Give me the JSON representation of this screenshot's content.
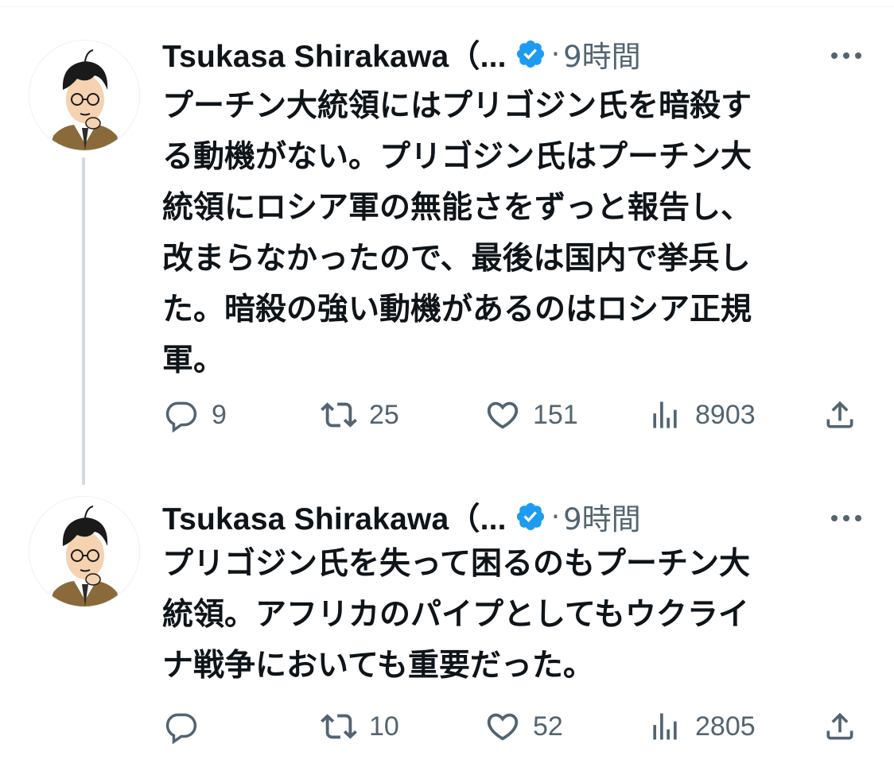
{
  "tweets": [
    {
      "display_name": "Tsukasa Shirakawa（...",
      "separator": "·",
      "time": "9時間",
      "text_lines": [
        "プーチン大統領にはプリゴジン氏を暗殺す",
        "る動機がない。プリゴジン氏はプーチン大",
        "統領にロシア軍の無能さをずっと報告し、",
        "改まらなかったので、最後は国内で挙兵し",
        "た。暗殺の強い動機があるのはロシア正規",
        "軍。"
      ],
      "replies": "9",
      "retweets": "25",
      "likes": "151",
      "views": "8903"
    },
    {
      "display_name": "Tsukasa Shirakawa（...",
      "separator": "·",
      "time": "9時間",
      "text_lines": [
        "プリゴジン氏を失って困るのもプーチン大",
        "統領。アフリカのパイプとしてもウクライ",
        "ナ戦争においても重要だった。"
      ],
      "replies": "",
      "retweets": "10",
      "likes": "52",
      "views": "2805"
    }
  ],
  "icons": {
    "verified": "verified-badge-icon",
    "more": "more-options-icon",
    "reply": "reply-icon",
    "retweet": "retweet-icon",
    "like": "heart-icon",
    "views": "views-bar-chart-icon",
    "share": "share-icon"
  },
  "colors": {
    "text": "#0f1419",
    "secondary": "#536471",
    "verified": "#1d9bf0",
    "thread_line": "#cfd9de"
  }
}
